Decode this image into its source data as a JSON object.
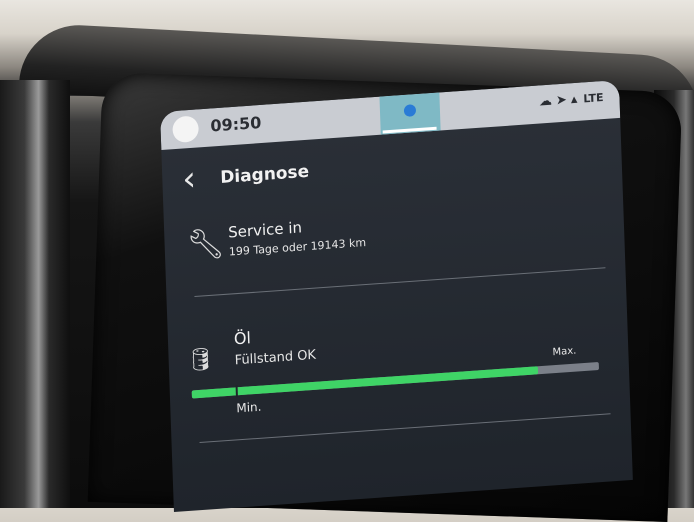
{
  "status": {
    "time": "09:50",
    "icons": [
      "cloud-icon",
      "location-arrow-icon",
      "signal-icon",
      "lte-icon"
    ],
    "lte": "LTE"
  },
  "header": {
    "title": "Diagnose"
  },
  "service": {
    "title": "Service in",
    "detail": "199 Tage oder 19143 km"
  },
  "oil": {
    "title": "Öl",
    "status": "Füllstand OK",
    "level": 0.85,
    "min_label": "Min.",
    "max_label": "Max."
  },
  "colors": {
    "gauge_fill": "#3fd466",
    "gauge_track": "#7b8089",
    "screen_bg": "#23282f"
  }
}
